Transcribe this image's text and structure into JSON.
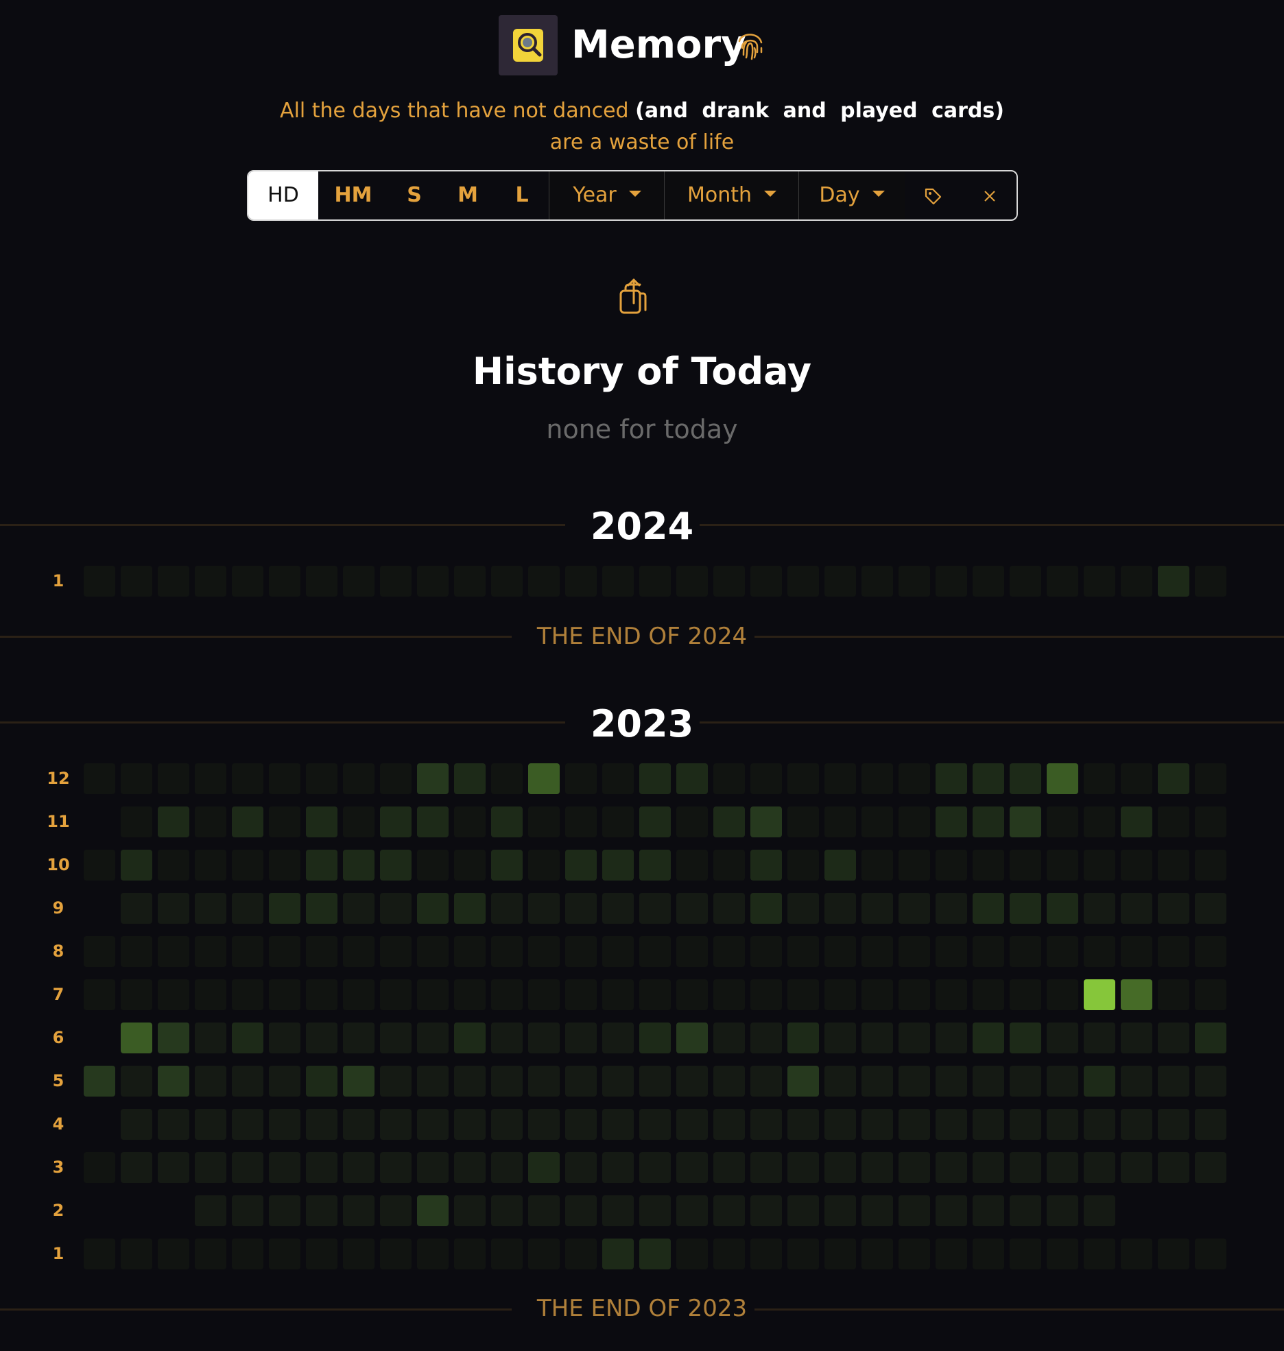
{
  "app": {
    "title": "Memory",
    "tagline_line1_plain": "All the days that have not danced",
    "tagline_line1_bold": "(and drank and played cards)",
    "tagline_line2": "are a waste of life"
  },
  "toolbar": {
    "sizes": [
      "HD",
      "HM",
      "S",
      "M",
      "L"
    ],
    "active_size": "HD",
    "year_label": "Year",
    "month_label": "Month",
    "day_label": "Day"
  },
  "icons": [
    "magnifier-logo-icon",
    "fingerprint-icon",
    "caret-down-icon",
    "tag-icon",
    "close-icon",
    "share-icon"
  ],
  "history": {
    "title": "History of Today",
    "empty_text": "none for today"
  },
  "colors": {
    "background": "#0b0b10",
    "accent": "#e4a23d",
    "levels": [
      "#111411",
      "#151a14",
      "#1d2a18",
      "#26391e",
      "#3b5c24",
      "#466b27",
      "#86c63a"
    ]
  },
  "calendar": {
    "columns": 31,
    "years": [
      {
        "year": "2024",
        "end_text": "THE END OF 2024",
        "rows": [
          {
            "month": "1",
            "levels": [
              0,
              0,
              0,
              0,
              0,
              0,
              0,
              0,
              0,
              0,
              0,
              0,
              0,
              0,
              0,
              0,
              0,
              0,
              0,
              0,
              0,
              0,
              0,
              0,
              0,
              0,
              0,
              0,
              0,
              2,
              0
            ]
          }
        ]
      },
      {
        "year": "2023",
        "end_text": "THE END OF 2023",
        "rows": [
          {
            "month": "12",
            "levels": [
              0,
              0,
              0,
              0,
              0,
              0,
              0,
              0,
              0,
              3,
              2,
              0,
              4,
              0,
              0,
              2,
              2,
              0,
              0,
              0,
              0,
              0,
              0,
              2,
              2,
              2,
              4,
              0,
              0,
              2,
              0
            ]
          },
          {
            "month": "11",
            "levels": [
              -1,
              0,
              2,
              0,
              2,
              0,
              2,
              0,
              2,
              2,
              0,
              2,
              0,
              0,
              0,
              2,
              0,
              2,
              3,
              0,
              0,
              0,
              0,
              2,
              2,
              3,
              0,
              0,
              2,
              0,
              0
            ]
          },
          {
            "month": "10",
            "levels": [
              0,
              2,
              0,
              0,
              0,
              0,
              2,
              2,
              2,
              0,
              0,
              2,
              0,
              2,
              2,
              2,
              0,
              0,
              2,
              0,
              2,
              0,
              0,
              0,
              0,
              0,
              0,
              0,
              0,
              0,
              0
            ]
          },
          {
            "month": "9",
            "levels": [
              -1,
              1,
              1,
              1,
              1,
              2,
              2,
              1,
              1,
              2,
              2,
              1,
              1,
              1,
              1,
              1,
              1,
              1,
              2,
              1,
              1,
              1,
              1,
              1,
              2,
              2,
              2,
              1,
              1,
              1,
              1
            ]
          },
          {
            "month": "8",
            "levels": [
              0,
              0,
              0,
              0,
              0,
              0,
              0,
              0,
              0,
              0,
              0,
              0,
              0,
              0,
              0,
              0,
              0,
              0,
              0,
              0,
              0,
              0,
              0,
              0,
              0,
              0,
              0,
              0,
              0,
              0,
              0
            ]
          },
          {
            "month": "7",
            "levels": [
              0,
              0,
              0,
              0,
              0,
              0,
              0,
              0,
              0,
              0,
              0,
              0,
              0,
              0,
              0,
              0,
              0,
              0,
              0,
              0,
              0,
              0,
              0,
              0,
              0,
              0,
              0,
              6,
              5,
              0,
              0
            ]
          },
          {
            "month": "6",
            "levels": [
              -1,
              4,
              3,
              1,
              2,
              1,
              1,
              1,
              1,
              1,
              2,
              1,
              1,
              1,
              1,
              2,
              3,
              1,
              1,
              2,
              1,
              1,
              1,
              1,
              2,
              2,
              1,
              1,
              1,
              1,
              2
            ]
          },
          {
            "month": "5",
            "levels": [
              3,
              1,
              3,
              1,
              1,
              1,
              2,
              3,
              1,
              1,
              1,
              1,
              1,
              1,
              1,
              1,
              1,
              1,
              1,
              3,
              1,
              1,
              1,
              1,
              1,
              1,
              1,
              2,
              1,
              1,
              1
            ]
          },
          {
            "month": "4",
            "levels": [
              -1,
              1,
              1,
              1,
              1,
              1,
              1,
              1,
              1,
              1,
              1,
              1,
              1,
              1,
              1,
              1,
              1,
              1,
              1,
              1,
              1,
              1,
              1,
              1,
              1,
              1,
              1,
              1,
              1,
              1,
              1
            ]
          },
          {
            "month": "3",
            "levels": [
              0,
              1,
              1,
              1,
              1,
              1,
              1,
              1,
              1,
              1,
              1,
              1,
              2,
              1,
              1,
              1,
              1,
              1,
              1,
              1,
              1,
              1,
              1,
              1,
              1,
              1,
              1,
              1,
              1,
              1,
              1
            ]
          },
          {
            "month": "2",
            "levels": [
              -1,
              -1,
              -1,
              1,
              1,
              1,
              1,
              1,
              1,
              3,
              1,
              1,
              1,
              1,
              1,
              1,
              1,
              1,
              1,
              1,
              1,
              1,
              1,
              1,
              1,
              1,
              1,
              1,
              -1,
              -1,
              -1
            ]
          },
          {
            "month": "1",
            "levels": [
              0,
              0,
              0,
              0,
              0,
              0,
              0,
              0,
              0,
              0,
              0,
              0,
              0,
              0,
              2,
              2,
              0,
              0,
              0,
              0,
              0,
              0,
              0,
              0,
              0,
              0,
              0,
              0,
              0,
              0,
              0
            ]
          }
        ]
      }
    ]
  }
}
